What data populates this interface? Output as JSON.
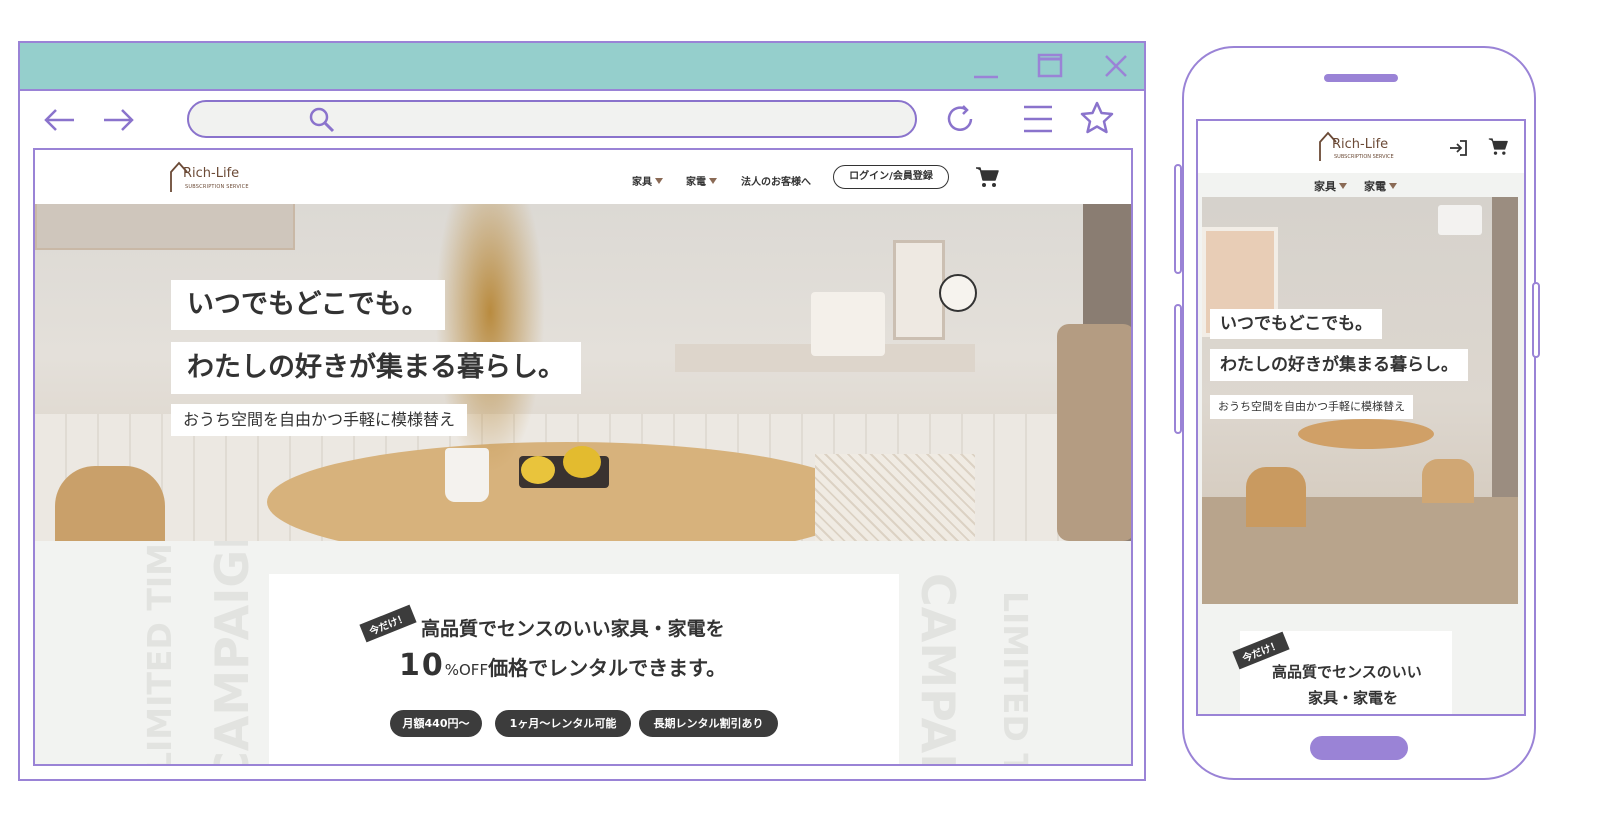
{
  "site": {
    "logo_main": "Rich-Life",
    "logo_sub": "SUBSCRIPTION SERVICE"
  },
  "nav": {
    "furniture": "家具",
    "appliances": "家電",
    "business": "法人のお客様へ",
    "login": "ログイン/会員登録"
  },
  "hero": {
    "line1": "いつでもどこでも。",
    "line2": "わたしの好きが集まる暮らし。",
    "line3": "おうち空間を自由かつ手軽に模様替え"
  },
  "campaign": {
    "tag": "今だけ！",
    "line1": "高品質でセンスのいい家具・家電を",
    "discount_number": "10",
    "discount_unit": "%OFF",
    "line2_rest": "価格でレンタルできます。",
    "pills": [
      "月額440円〜",
      "1ヶ月〜レンタル可能",
      "長期レンタル割引あり"
    ],
    "bg_text_limited": "LIMITED TIME",
    "bg_text_campaign": "CAMPAIGN"
  },
  "mobile": {
    "hero_line1": "いつでもどこでも。",
    "hero_line2": "わたしの好きが集まる暮らし。",
    "hero_line3": "おうち空間を自由かつ手軽に模様替え",
    "tag": "今だけ！",
    "card_line1": "高品質でセンスのいい",
    "card_line2": "家具・家電を"
  },
  "colors": {
    "frame": "#9a83d6",
    "titlebar": "#95cfcc",
    "logo": "#6b4a36",
    "pill": "#3c3c3c"
  }
}
